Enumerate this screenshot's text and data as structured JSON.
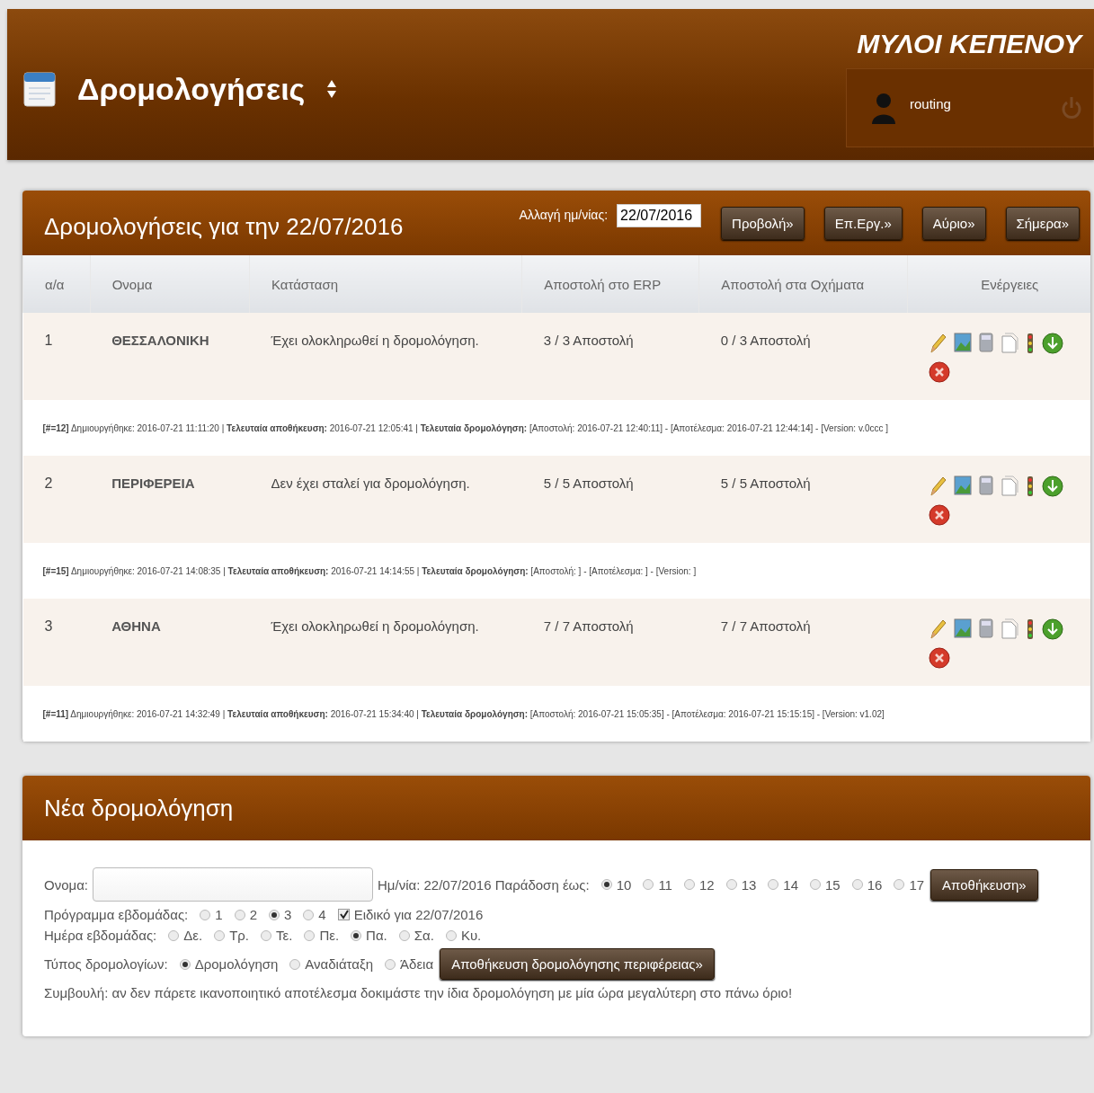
{
  "header": {
    "title": "Δρομολογήσεις",
    "company": "ΜΥΛΟΙ ΚΕΠΕΝΟΥ",
    "user": "routing"
  },
  "routes_panel": {
    "title": "Δρομολογήσεις για την 22/07/2016",
    "date_label": "Αλλαγή ημ/νίας:",
    "date_value": "22/07/2016",
    "buttons": [
      "Προβολή»",
      "Επ.Εργ.»",
      "Αύριο»",
      "Σήμερα»"
    ],
    "table": {
      "columns": [
        "α/α",
        "Ονομα",
        "Κατάσταση",
        "Αποστολή στο ERP",
        "Αποστολή στα Οχήματα",
        "Ενέργειες"
      ],
      "rows": [
        {
          "number": "1",
          "name": "ΘΕΣΣΑΛΟΝΙΚΗ",
          "status": "Έχει ολοκληρωθεί η δρομολόγηση.",
          "erp": "3 / 3 Αποστολή",
          "vehicles": "0 / 3 Αποστολή",
          "meta": "**[#=12]** Δημιουργήθηκε: 2016-07-21 11:11:20 | **Τελευταία αποθήκευση:** 2016-07-21 12:05:41 | **Τελευταία δρομολόγηση:** [Αποστολή: 2016-07-21 12:40:11] - [Αποτέλεσμα: 2016-07-21 12:44:14] - [Version: v.0ccc ]"
        },
        {
          "number": "2",
          "name": "ΠΕΡΙΦΕΡΕΙΑ",
          "status": "Δεν έχει σταλεί για δρομολόγηση.",
          "erp": "5 / 5 Αποστολή",
          "vehicles": "5 / 5 Αποστολή",
          "meta": "**[#=15]** Δημιουργήθηκε: 2016-07-21 14:08:35 | **Τελευταία αποθήκευση:** 2016-07-21 14:14:55 | **Τελευταία δρομολόγηση:** [Αποστολή: ] - [Αποτέλεσμα: ] - [Version: ]"
        },
        {
          "number": "3",
          "name": "ΑΘΗΝΑ",
          "status": "Έχει ολοκληρωθεί η δρομολόγηση.",
          "erp": "7 / 7 Αποστολή",
          "vehicles": "7 / 7 Αποστολή",
          "meta": "**[#=11]** Δημιουργήθηκε: 2016-07-21 14:32:49 | **Τελευταία αποθήκευση:** 2016-07-21 15:34:40 | **Τελευταία δρομολόγηση:** [Αποστολή: 2016-07-21 15:05:35] - [Αποτέλεσμα: 2016-07-21 15:15:15] - [Version: v1.02]"
        }
      ]
    }
  },
  "new_route": {
    "title": "Νέα δρομολόγηση",
    "name_label": "Ονομα:",
    "date_text": "Ημ/νία: 22/07/2016 Παράδοση έως:",
    "delivery": [
      {
        "label": "10",
        "selected": true
      },
      {
        "label": "11",
        "selected": false
      },
      {
        "label": "12",
        "selected": false
      },
      {
        "label": "13",
        "selected": false
      },
      {
        "label": "14",
        "selected": false
      },
      {
        "label": "15",
        "selected": false
      },
      {
        "label": "16",
        "selected": false
      },
      {
        "label": "17",
        "selected": false
      }
    ],
    "save_button": "Αποθήκευση»",
    "week_program_label": "Πρόγραμμα εβδομάδας:",
    "week_program": [
      {
        "label": "1",
        "selected": false
      },
      {
        "label": "2",
        "selected": false
      },
      {
        "label": "3",
        "selected": true
      },
      {
        "label": "4",
        "selected": false
      }
    ],
    "special": {
      "label": "Ειδικό για 22/07/2016",
      "checked": true
    },
    "weekday_label": "Ημέρα εβδομάδας:",
    "weekdays": [
      {
        "label": "Δε.",
        "selected": false
      },
      {
        "label": "Τρ.",
        "selected": false
      },
      {
        "label": "Τε.",
        "selected": false
      },
      {
        "label": "Πε.",
        "selected": false
      },
      {
        "label": "Πα.",
        "selected": true
      },
      {
        "label": "Σα.",
        "selected": false
      },
      {
        "label": "Κυ.",
        "selected": false
      }
    ],
    "type_label": "Τύπος δρομολογίων:",
    "types": [
      {
        "label": "Δρομολόγηση",
        "selected": true
      },
      {
        "label": "Αναδιάταξη",
        "selected": false
      },
      {
        "label": "Άδεια",
        "selected": false
      }
    ],
    "region_button": "Αποθήκευση δρομολόγησης περιφέρειας»",
    "tip": "Συμβουλή: αν δεν πάρετε ικανοποιητικό αποτέλεσμα δοκιμάστε την ίδια δρομολόγηση με μία ώρα μεγαλύτερη στο πάνω όριο!"
  }
}
